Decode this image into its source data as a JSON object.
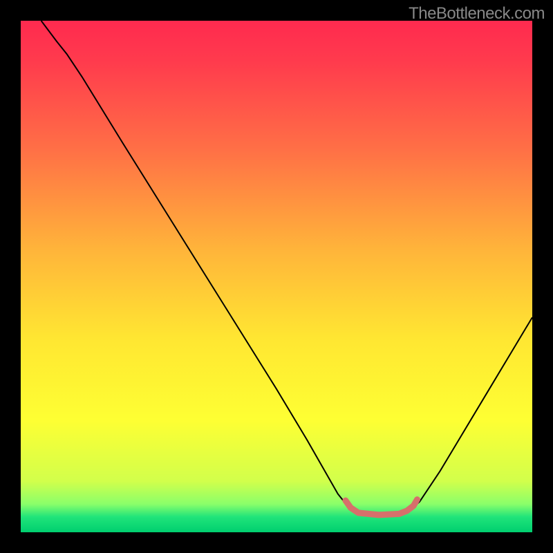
{
  "watermark": "TheBottleneck.com",
  "chart_data": {
    "type": "line",
    "title": "",
    "xlabel": "",
    "ylabel": "",
    "xlim": [
      0,
      100
    ],
    "ylim": [
      0,
      100
    ],
    "background_gradient": {
      "stops": [
        {
          "pos": 0.0,
          "color": "#ff2a4f"
        },
        {
          "pos": 0.08,
          "color": "#ff3b4d"
        },
        {
          "pos": 0.25,
          "color": "#ff6f46"
        },
        {
          "pos": 0.45,
          "color": "#ffb53a"
        },
        {
          "pos": 0.62,
          "color": "#ffe632"
        },
        {
          "pos": 0.78,
          "color": "#feff33"
        },
        {
          "pos": 0.9,
          "color": "#d2ff4b"
        },
        {
          "pos": 0.945,
          "color": "#8aff6a"
        },
        {
          "pos": 0.97,
          "color": "#20e47a"
        },
        {
          "pos": 1.0,
          "color": "#00cf6f"
        }
      ]
    },
    "series": [
      {
        "name": "bottleneck-curve",
        "color": "#000000",
        "width": 2,
        "points": [
          {
            "x": 4,
            "y": 100
          },
          {
            "x": 7,
            "y": 96
          },
          {
            "x": 9,
            "y": 93.5
          },
          {
            "x": 12,
            "y": 89
          },
          {
            "x": 20,
            "y": 76
          },
          {
            "x": 30,
            "y": 60
          },
          {
            "x": 40,
            "y": 44
          },
          {
            "x": 50,
            "y": 28
          },
          {
            "x": 56,
            "y": 18
          },
          {
            "x": 60,
            "y": 11
          },
          {
            "x": 62,
            "y": 7.5
          },
          {
            "x": 64,
            "y": 5
          },
          {
            "x": 66,
            "y": 3.8
          },
          {
            "x": 70,
            "y": 3.4
          },
          {
            "x": 74,
            "y": 3.6
          },
          {
            "x": 76.5,
            "y": 4.6
          },
          {
            "x": 78,
            "y": 6
          },
          {
            "x": 82,
            "y": 12
          },
          {
            "x": 88,
            "y": 22
          },
          {
            "x": 94,
            "y": 32
          },
          {
            "x": 100,
            "y": 42
          }
        ]
      },
      {
        "name": "optimum-band",
        "color": "#d6706b",
        "width": 9,
        "cap": "round",
        "points": [
          {
            "x": 63.5,
            "y": 6.2
          },
          {
            "x": 64.5,
            "y": 4.8
          },
          {
            "x": 66,
            "y": 3.8
          },
          {
            "x": 70,
            "y": 3.4
          },
          {
            "x": 74,
            "y": 3.6
          },
          {
            "x": 75.5,
            "y": 4.2
          },
          {
            "x": 76.8,
            "y": 5.2
          },
          {
            "x": 77.5,
            "y": 6.4
          }
        ]
      }
    ]
  }
}
